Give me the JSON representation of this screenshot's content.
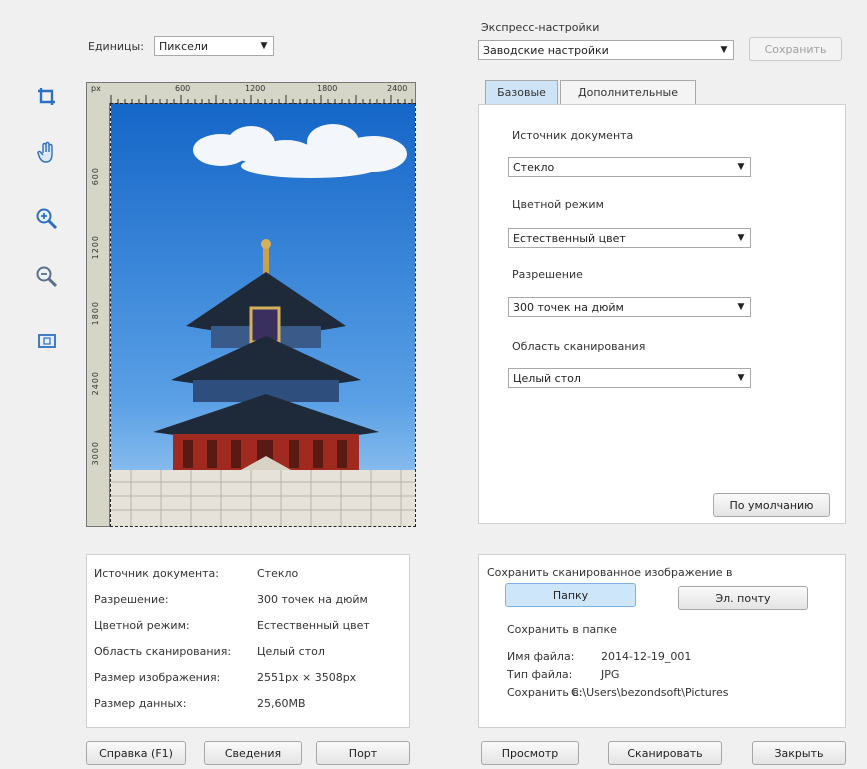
{
  "units": {
    "label": "Единицы:",
    "value": "Пиксели"
  },
  "ruler": {
    "unit": "px",
    "top_ticks": [
      "600",
      "1200",
      "1800",
      "2400"
    ],
    "left_ticks": [
      "600",
      "1200",
      "1800",
      "2400",
      "3000"
    ]
  },
  "express": {
    "label": "Экспресс-настройки",
    "value": "Заводские настройки",
    "save_label": "Сохранить"
  },
  "tabs": [
    {
      "label": "Базовые",
      "active": true
    },
    {
      "label": "Дополнительные",
      "active": false
    }
  ],
  "settings": {
    "source": {
      "label": "Источник документа",
      "value": "Стекло"
    },
    "color": {
      "label": "Цветной режим",
      "value": "Естественный цвет"
    },
    "resolution": {
      "label": "Разрешение",
      "value": "300 точек на дюйм"
    },
    "area": {
      "label": "Область сканирования",
      "value": "Целый стол"
    },
    "default_button": "По умолчанию"
  },
  "info": [
    {
      "key": "Источник документа:",
      "value": "Стекло"
    },
    {
      "key": "Разрешение:",
      "value": "300 точек на дюйм"
    },
    {
      "key": "Цветной режим:",
      "value": "Естественный цвет"
    },
    {
      "key": "Область сканирования:",
      "value": "Целый стол"
    },
    {
      "key": "Размер изображения:",
      "value": "2551px × 3508px"
    },
    {
      "key": "Размер данных:",
      "value": "25,60MB"
    }
  ],
  "save": {
    "title": "Сохранить сканированное изображение в",
    "folder_button": "Папку",
    "email_button": "Эл. почту",
    "subtitle": "Сохранить в папке",
    "file_name_label": "Имя файла:",
    "file_name_value": "2014-12-19_001",
    "file_type_label": "Тип файла:",
    "file_type_value": "JPG",
    "save_to_label": "Сохранить в:",
    "save_to_value": "C:\\Users\\bezondsoft\\Pictures"
  },
  "bottom": {
    "help": "Справка (F1)",
    "about": "Сведения",
    "port": "Порт",
    "preview": "Просмотр",
    "scan": "Сканировать",
    "close": "Закрыть"
  },
  "colors": {
    "accent": "#2f6fbf",
    "tab_active": "#cfe3f7",
    "folder_active": "#cde6fa"
  }
}
